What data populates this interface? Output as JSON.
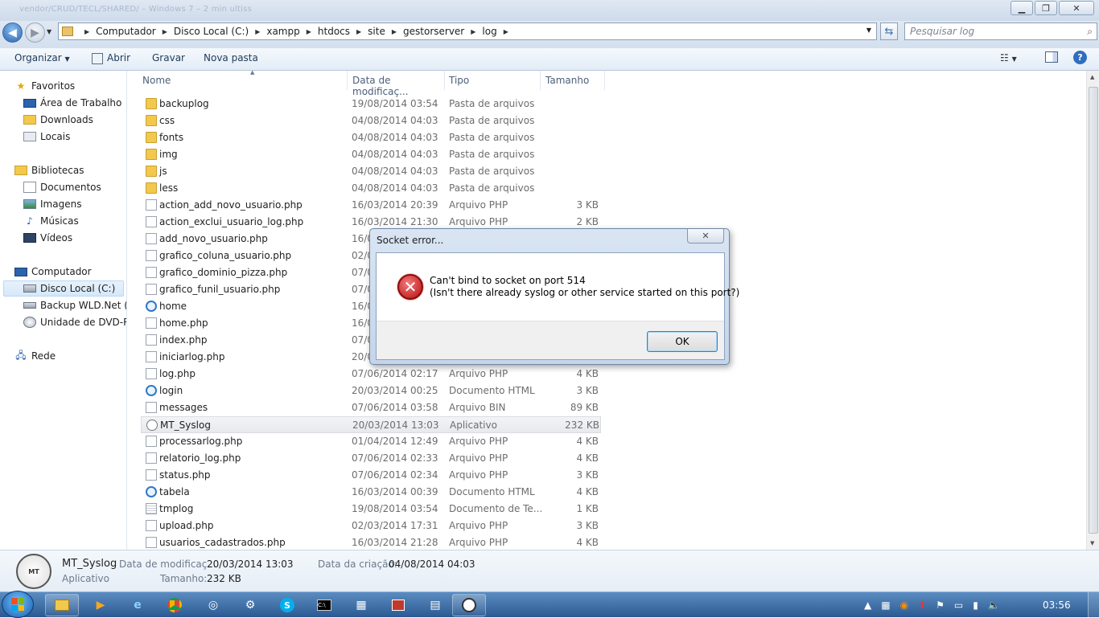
{
  "window": {
    "title": "vendor/CRUD/TECL/SHARED/ – Windows 7 – 2 min ultiss"
  },
  "address": {
    "crumbs": [
      "Computador",
      "Disco Local (C:)",
      "xampp",
      "htdocs",
      "site",
      "gestorserver",
      "log"
    ],
    "search_placeholder": "Pesquisar log"
  },
  "toolbar": {
    "organize": "Organizar",
    "open": "Abrir",
    "burn": "Gravar",
    "new_folder": "Nova pasta"
  },
  "nav": {
    "favorites": {
      "label": "Favoritos",
      "items": [
        "Área de Trabalho",
        "Downloads",
        "Locais"
      ]
    },
    "libraries": {
      "label": "Bibliotecas",
      "items": [
        "Documentos",
        "Imagens",
        "Músicas",
        "Vídeos"
      ]
    },
    "computer": {
      "label": "Computador",
      "items": [
        "Disco Local (C:)",
        "Backup WLD.Net (D:",
        "Unidade de DVD-RW"
      ]
    },
    "network": {
      "label": "Rede"
    }
  },
  "columns": {
    "name": "Nome",
    "date": "Data de modificaç...",
    "type": "Tipo",
    "size": "Tamanho"
  },
  "files": [
    {
      "name": "backuplog",
      "date": "19/08/2014 03:54",
      "type": "Pasta de arquivos",
      "size": "",
      "icon": "folder"
    },
    {
      "name": "css",
      "date": "04/08/2014 04:03",
      "type": "Pasta de arquivos",
      "size": "",
      "icon": "folder"
    },
    {
      "name": "fonts",
      "date": "04/08/2014 04:03",
      "type": "Pasta de arquivos",
      "size": "",
      "icon": "folder"
    },
    {
      "name": "img",
      "date": "04/08/2014 04:03",
      "type": "Pasta de arquivos",
      "size": "",
      "icon": "folder"
    },
    {
      "name": "js",
      "date": "04/08/2014 04:03",
      "type": "Pasta de arquivos",
      "size": "",
      "icon": "folder"
    },
    {
      "name": "less",
      "date": "04/08/2014 04:03",
      "type": "Pasta de arquivos",
      "size": "",
      "icon": "folder"
    },
    {
      "name": "action_add_novo_usuario.php",
      "date": "16/03/2014 20:39",
      "type": "Arquivo PHP",
      "size": "3 KB",
      "icon": "file"
    },
    {
      "name": "action_exclui_usuario_log.php",
      "date": "16/03/2014 21:30",
      "type": "Arquivo PHP",
      "size": "2 KB",
      "icon": "file"
    },
    {
      "name": "add_novo_usuario.php",
      "date": "16/0",
      "type": "",
      "size": "",
      "icon": "file"
    },
    {
      "name": "grafico_coluna_usuario.php",
      "date": "02/0",
      "type": "",
      "size": "",
      "icon": "file"
    },
    {
      "name": "grafico_dominio_pizza.php",
      "date": "07/0",
      "type": "",
      "size": "",
      "icon": "file"
    },
    {
      "name": "grafico_funil_usuario.php",
      "date": "07/0",
      "type": "",
      "size": "",
      "icon": "file"
    },
    {
      "name": "home",
      "date": "16/0",
      "type": "",
      "size": "",
      "icon": "ie"
    },
    {
      "name": "home.php",
      "date": "16/0",
      "type": "",
      "size": "",
      "icon": "file"
    },
    {
      "name": "index.php",
      "date": "07/0",
      "type": "",
      "size": "",
      "icon": "file"
    },
    {
      "name": "iniciarlog.php",
      "date": "20/0",
      "type": "",
      "size": "",
      "icon": "file"
    },
    {
      "name": "log.php",
      "date": "07/06/2014 02:17",
      "type": "Arquivo PHP",
      "size": "4 KB",
      "icon": "file"
    },
    {
      "name": "login",
      "date": "20/03/2014 00:25",
      "type": "Documento HTML",
      "size": "3 KB",
      "icon": "ie"
    },
    {
      "name": "messages",
      "date": "07/06/2014 03:58",
      "type": "Arquivo BIN",
      "size": "89 KB",
      "icon": "file"
    },
    {
      "name": "MT_Syslog",
      "date": "20/03/2014 13:03",
      "type": "Aplicativo",
      "size": "232 KB",
      "icon": "app",
      "selected": true
    },
    {
      "name": "processarlog.php",
      "date": "01/04/2014 12:49",
      "type": "Arquivo PHP",
      "size": "4 KB",
      "icon": "file"
    },
    {
      "name": "relatorio_log.php",
      "date": "07/06/2014 02:33",
      "type": "Arquivo PHP",
      "size": "4 KB",
      "icon": "file"
    },
    {
      "name": "status.php",
      "date": "07/06/2014 02:34",
      "type": "Arquivo PHP",
      "size": "3 KB",
      "icon": "file"
    },
    {
      "name": "tabela",
      "date": "16/03/2014 00:39",
      "type": "Documento HTML",
      "size": "4 KB",
      "icon": "ie"
    },
    {
      "name": "tmplog",
      "date": "19/08/2014 03:54",
      "type": "Documento de Te...",
      "size": "1 KB",
      "icon": "txt"
    },
    {
      "name": "upload.php",
      "date": "02/03/2014 17:31",
      "type": "Arquivo PHP",
      "size": "3 KB",
      "icon": "file"
    },
    {
      "name": "usuarios_cadastrados.php",
      "date": "16/03/2014 21:28",
      "type": "Arquivo PHP",
      "size": "4 KB",
      "icon": "file"
    }
  ],
  "details": {
    "name": "MT_Syslog",
    "kind": "Aplicativo",
    "mod_label": "Data de modificaç...",
    "mod_value": "20/03/2014 13:03",
    "size_label": "Tamanho:",
    "size_value": "232 KB",
    "created_label": "Data da criação:",
    "created_value": "04/08/2014 04:03"
  },
  "dialog": {
    "title": "Socket error...",
    "line1": "Can't bind to socket on port 514",
    "line2": "(Isn't there already syslog or other service started on this port?)",
    "ok": "OK"
  },
  "taskbar": {
    "clock": "03:56"
  },
  "colors": {
    "taskbar": "#2b5a92",
    "error": "#b50d0d",
    "folder": "#f2c94c"
  }
}
